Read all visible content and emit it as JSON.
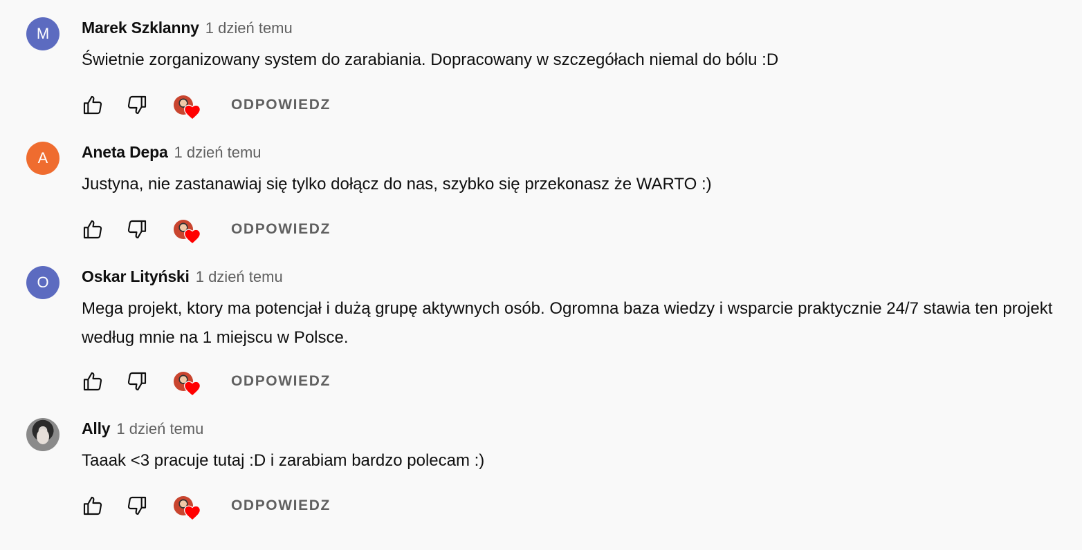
{
  "comments": [
    {
      "author": "Marek Szklanny",
      "avatar_letter": "M",
      "avatar_color": "#5c6bc0",
      "time": "1 dzień temu",
      "text": "Świetnie zorganizowany system do zarabiania. Dopracowany w szczegółach niemal do bólu :D",
      "reply_label": "ODPOWIEDZ"
    },
    {
      "author": "Aneta Depa",
      "avatar_letter": "A",
      "avatar_color": "#ef6c2f",
      "time": "1 dzień temu",
      "text": "Justyna, nie zastanawiaj się tylko dołącz do nas, szybko się przekonasz że WARTO :)",
      "reply_label": "ODPOWIEDZ"
    },
    {
      "author": "Oskar Lityński",
      "avatar_letter": "O",
      "avatar_color": "#5c6bc0",
      "time": "1 dzień temu",
      "text": "Mega projekt, ktory ma potencjał i dużą grupę aktywnych osób. Ogromna baza wiedzy i wsparcie praktycznie 24/7 stawia ten projekt według mnie na 1 miejscu w Polsce.",
      "reply_label": "ODPOWIEDZ"
    },
    {
      "author": "Ally",
      "avatar_letter": "",
      "avatar_color": "#555555",
      "time": "1 dzień temu",
      "text": "Taaak <3 pracuje tutaj :D i zarabiam bardzo polecam :)",
      "reply_label": "ODPOWIEDZ"
    }
  ],
  "icons": {
    "like": "thumbs-up-icon",
    "dislike": "thumbs-down-icon",
    "creator_heart": "heart-icon"
  },
  "colors": {
    "heart": "#ff0000",
    "secondary_text": "#606060",
    "background": "#f9f9f9"
  }
}
